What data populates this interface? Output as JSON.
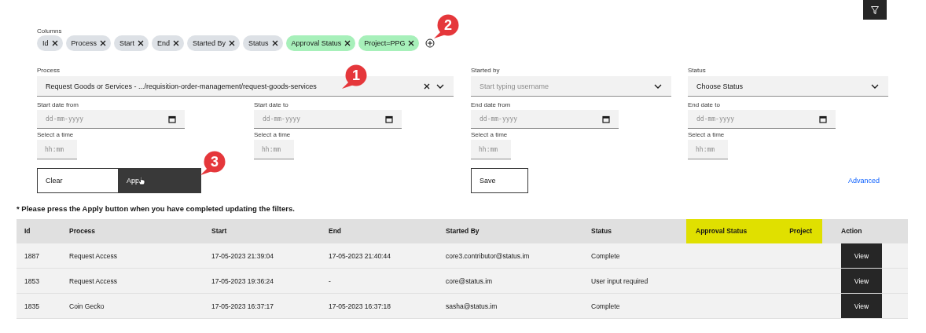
{
  "columns_filter": {
    "label": "Columns",
    "chips": [
      {
        "label": "Id",
        "color": "#dde1e6"
      },
      {
        "label": "Process",
        "color": "#dde1e6"
      },
      {
        "label": "Start",
        "color": "#dde1e6"
      },
      {
        "label": "End",
        "color": "#dde1e6"
      },
      {
        "label": "Started By",
        "color": "#dde1e6"
      },
      {
        "label": "Status",
        "color": "#dde1e6"
      },
      {
        "label": "Approval Status",
        "color": "#a7f0ba"
      },
      {
        "label": "Project=PPG",
        "color": "#a7f0ba"
      }
    ]
  },
  "filters": {
    "process": {
      "label": "Process",
      "value": "Request Goods or Services - .../requisition-order-management/request-goods-services"
    },
    "started_by": {
      "label": "Started by",
      "placeholder": "Start typing username"
    },
    "status": {
      "label": "Status",
      "value": "Choose Status"
    },
    "dates": [
      {
        "label": "Start date from",
        "placeholder": "dd-mm-yyyy",
        "time_label": "Select a time",
        "time_placeholder": "hh:mm"
      },
      {
        "label": "Start date to",
        "placeholder": "dd-mm-yyyy",
        "time_label": "Select a time",
        "time_placeholder": "hh:mm"
      },
      {
        "label": "End date from",
        "placeholder": "dd-mm-yyyy",
        "time_label": "Select a time",
        "time_placeholder": "hh:mm"
      },
      {
        "label": "End date to",
        "placeholder": "dd-mm-yyyy",
        "time_label": "Select a time",
        "time_placeholder": "hh:mm"
      }
    ],
    "buttons": {
      "clear": "Clear",
      "apply": "App",
      "save": "Save",
      "advanced": "Advanced"
    }
  },
  "note": "* Please press the Apply button when you have completed updating the filters.",
  "table": {
    "columns": [
      {
        "label": "Id",
        "highlighted": false
      },
      {
        "label": "Process",
        "highlighted": false
      },
      {
        "label": "Start",
        "highlighted": false
      },
      {
        "label": "End",
        "highlighted": false
      },
      {
        "label": "Started By",
        "highlighted": false
      },
      {
        "label": "Status",
        "highlighted": false
      },
      {
        "label": "Approval Status",
        "highlighted": true
      },
      {
        "label": "Project",
        "highlighted": true
      },
      {
        "label": "Action",
        "highlighted": false
      }
    ],
    "rows": [
      {
        "cells": [
          "1887",
          "Request Access",
          "17-05-2023 21:39:04",
          "17-05-2023 21:40:44",
          "core3.contributor@status.im",
          "Complete"
        ],
        "action": "View"
      },
      {
        "cells": [
          "1853",
          "Request Access",
          "17-05-2023 19:36:24",
          "-",
          "core@status.im",
          "User input required"
        ],
        "action": "View"
      },
      {
        "cells": [
          "1835",
          "Coin Gecko",
          "17-05-2023 16:37:17",
          "17-05-2023 16:37:18",
          "sasha@status.im",
          "Complete"
        ],
        "action": "View"
      }
    ]
  },
  "callouts": [
    {
      "number": "1"
    },
    {
      "number": "2"
    },
    {
      "number": "3"
    }
  ]
}
